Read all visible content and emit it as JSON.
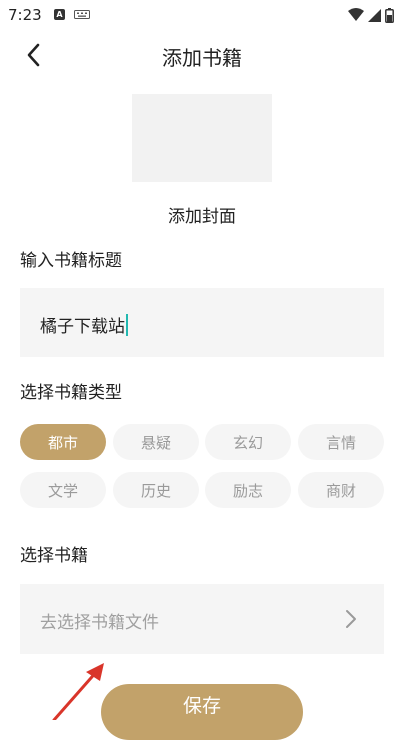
{
  "status_bar": {
    "time": "7:23",
    "a_label": "A"
  },
  "header": {
    "title": "添加书籍"
  },
  "cover": {
    "label": "添加封面"
  },
  "title_section": {
    "label": "输入书籍标题",
    "value": "橘子下载站"
  },
  "type_section": {
    "label": "选择书籍类型",
    "tags": [
      {
        "label": "都市",
        "selected": true
      },
      {
        "label": "悬疑",
        "selected": false
      },
      {
        "label": "玄幻",
        "selected": false
      },
      {
        "label": "言情",
        "selected": false
      },
      {
        "label": "文学",
        "selected": false
      },
      {
        "label": "历史",
        "selected": false
      },
      {
        "label": "励志",
        "selected": false
      },
      {
        "label": "商财",
        "selected": false
      }
    ]
  },
  "file_section": {
    "label": "选择书籍",
    "placeholder": "去选择书籍文件"
  },
  "save_button": {
    "label": "保存"
  },
  "colors": {
    "accent": "#c2a26a",
    "annotation_arrow": "#d9352a",
    "caret": "#22b8b0"
  }
}
